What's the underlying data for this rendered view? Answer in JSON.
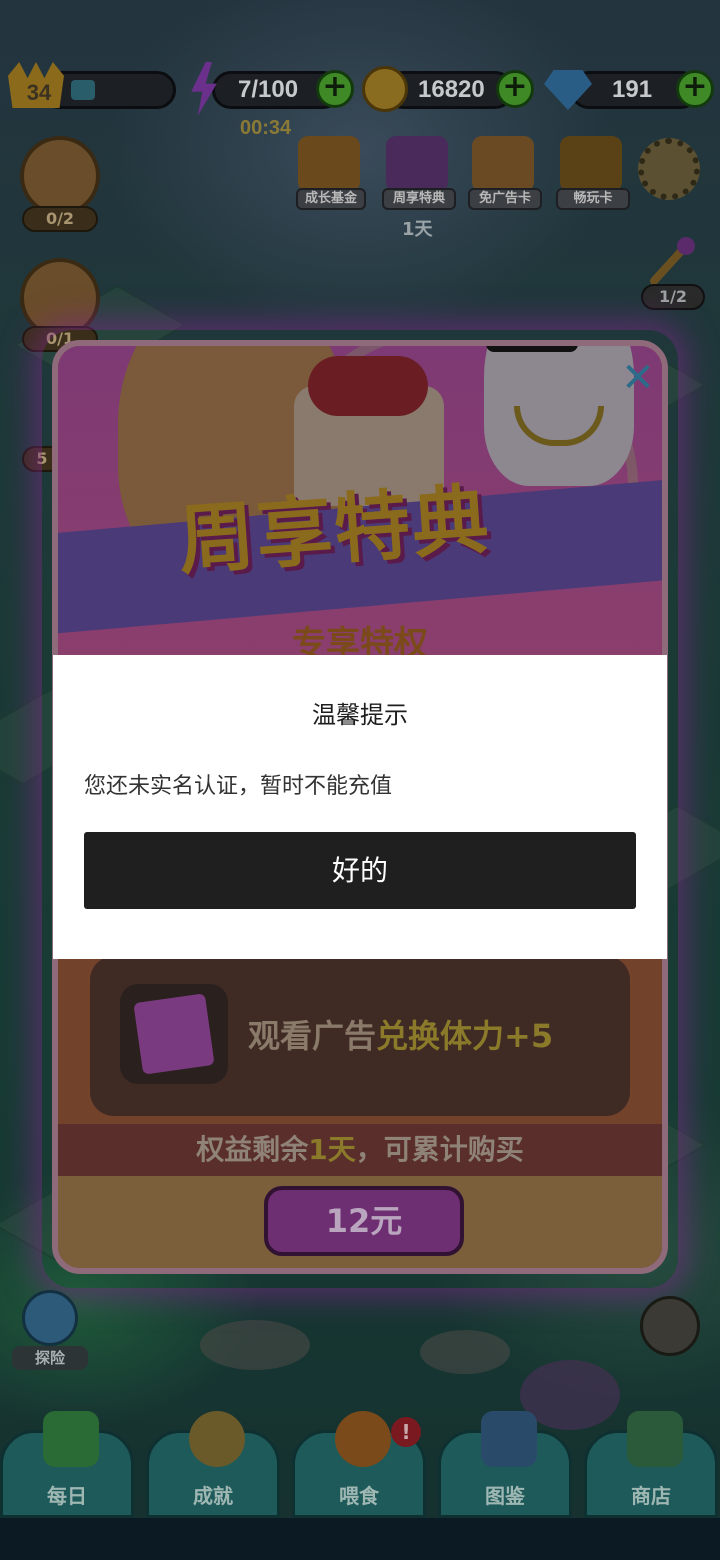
{
  "colors": {
    "dialog_bg": "#ffffff",
    "ok_button_bg": "#1f1f1f",
    "ok_button_text": "#ffffff"
  },
  "hud": {
    "level": "34",
    "energy": "7/100",
    "energy_timer": "00:34",
    "coins": "16820",
    "gems": "191",
    "shop_items": [
      {
        "label": "成长基金",
        "icon": "growth-fund-icon"
      },
      {
        "label": "周享特典",
        "icon": "weekly-pack-icon"
      },
      {
        "label": "免广告卡",
        "icon": "no-ads-card-icon"
      },
      {
        "label": "畅玩卡",
        "icon": "crown-card-icon"
      }
    ],
    "weekly_days_left": "1天",
    "side_counts": [
      "0/2",
      "0/1",
      "5"
    ],
    "wand_count": "1/2"
  },
  "promo": {
    "title": "周享特典",
    "subtitle": "专享特权",
    "ad_text_prefix": "观看广告",
    "ad_text_highlight": "兑换体力+5",
    "remaining_prefix": "权益剩余",
    "remaining_days": "1天",
    "remaining_suffix": "，可累计购买",
    "price": "12元",
    "close_icon": "close-icon"
  },
  "dialog": {
    "title": "温馨提示",
    "message": "您还未实名认证，暂时不能充值",
    "ok_label": "好的"
  },
  "nav": {
    "explore": "探险",
    "items": [
      "每日",
      "成就",
      "喂食",
      "图鉴",
      "商店"
    ]
  }
}
